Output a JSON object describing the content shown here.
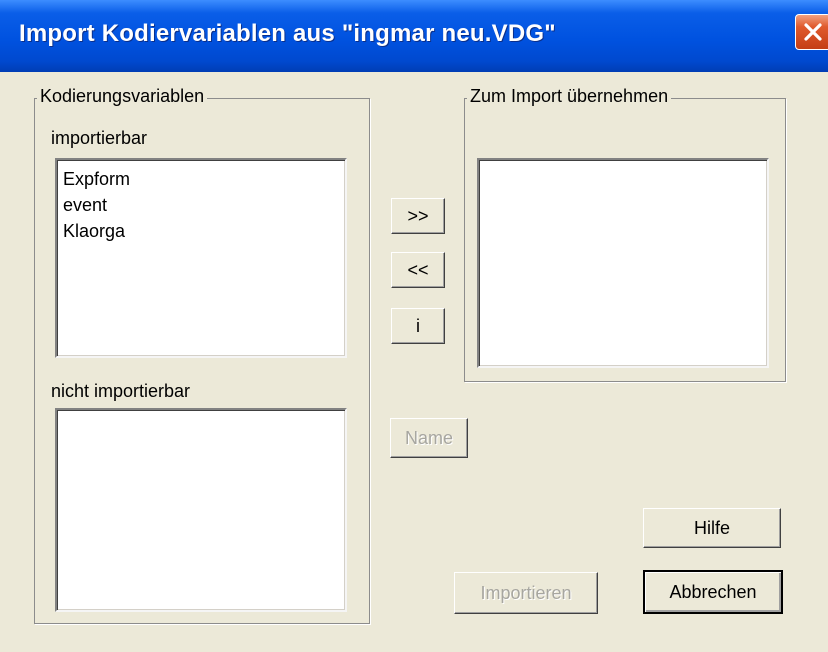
{
  "window": {
    "title": "Import Kodiervariablen aus \"ingmar neu.VDG\"",
    "close_icon": "close-icon"
  },
  "left_group": {
    "legend": "Kodierungsvariablen",
    "importable_label": "importierbar",
    "importable_items": [
      "Expform",
      "event",
      "Klaorga"
    ],
    "not_importable_label": "nicht importierbar",
    "not_importable_items": []
  },
  "right_group": {
    "legend": "Zum Import übernehmen",
    "items": []
  },
  "buttons": {
    "add": ">>",
    "remove": "<<",
    "info": "i",
    "name": "Name",
    "help": "Hilfe",
    "import": "Importieren",
    "cancel": "Abbrechen"
  },
  "colors": {
    "titlebar": "#0052e0",
    "dialog_bg": "#ece9d8",
    "close_button": "#e05a2c"
  }
}
